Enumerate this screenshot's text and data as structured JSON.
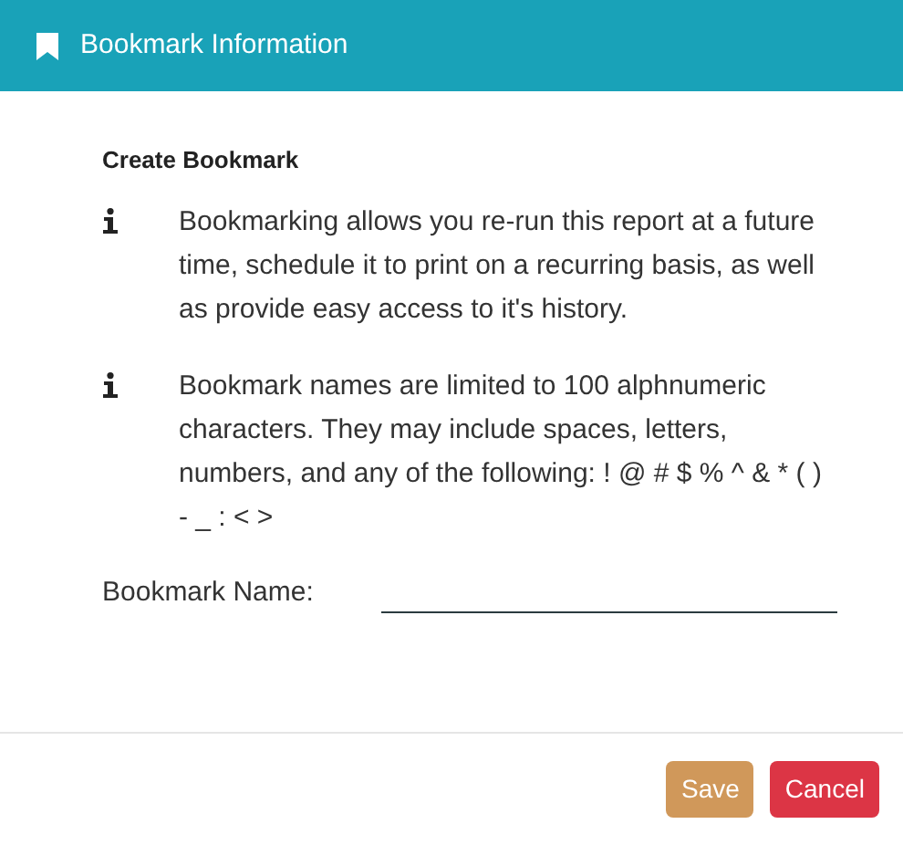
{
  "dialog": {
    "title": "Bookmark Information"
  },
  "heading": "Create Bookmark",
  "notes": [
    {
      "text": "Bookmarking allows you re-run this report at a future time, schedule it to print on a recurring basis, as well as provide easy access to it's history."
    },
    {
      "text": "Bookmark names are limited to 100 alphnumeric characters. They may include spaces, letters, numbers, and any of the following: ! @ # $ % ^ & * ( ) - _ : < >"
    }
  ],
  "field": {
    "label": "Bookmark Name:"
  },
  "buttons": [
    {
      "label": "Save",
      "kind": "save"
    },
    {
      "label": "Cancel",
      "kind": "cancel"
    }
  ]
}
